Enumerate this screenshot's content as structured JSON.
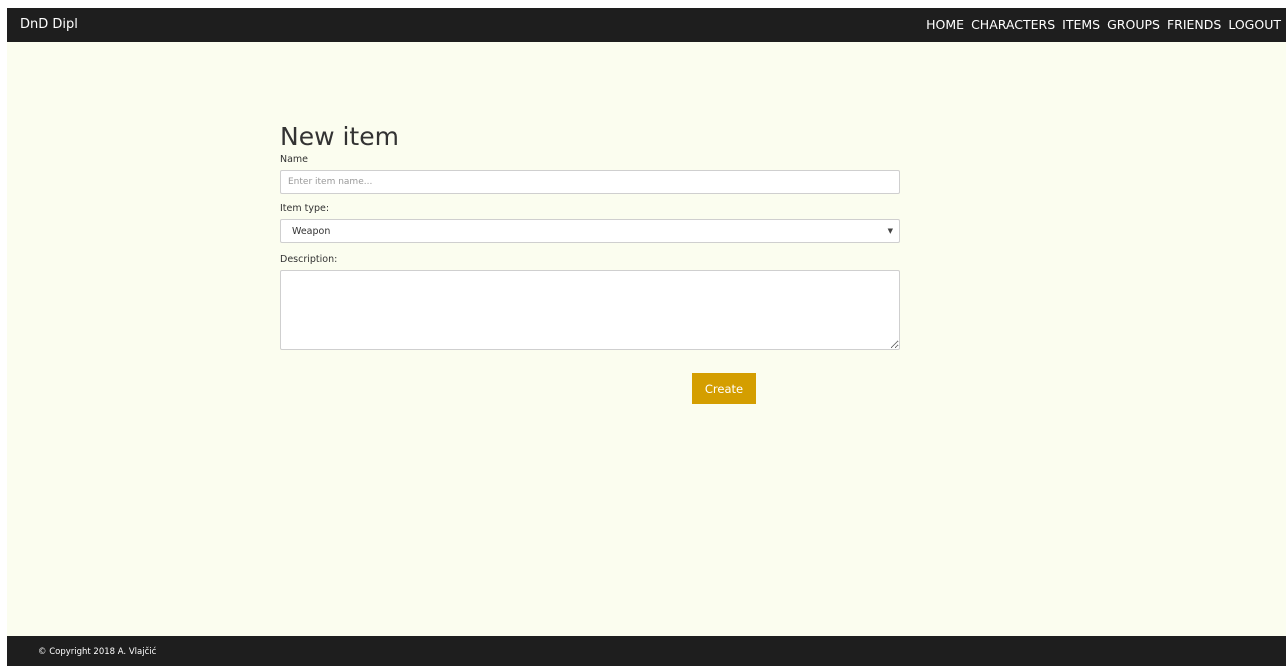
{
  "navbar": {
    "brand": "DnD Dipl",
    "links": [
      {
        "label": "HOME"
      },
      {
        "label": "CHARACTERS"
      },
      {
        "label": "ITEMS"
      },
      {
        "label": "GROUPS"
      },
      {
        "label": "FRIENDS"
      },
      {
        "label": "LOGOUT"
      }
    ]
  },
  "form": {
    "title": "New item",
    "name_label": "Name",
    "name_placeholder": "Enter item name...",
    "name_value": "",
    "type_label": "Item type:",
    "type_value": "Weapon",
    "description_label": "Description:",
    "description_value": "",
    "create_label": "Create"
  },
  "footer": {
    "copyright": "© Copyright 2018 A. Vlajčić"
  },
  "colors": {
    "navbar_bg": "#1e1e1e",
    "page_bg": "#fbfdef",
    "accent": "#d49e00"
  }
}
